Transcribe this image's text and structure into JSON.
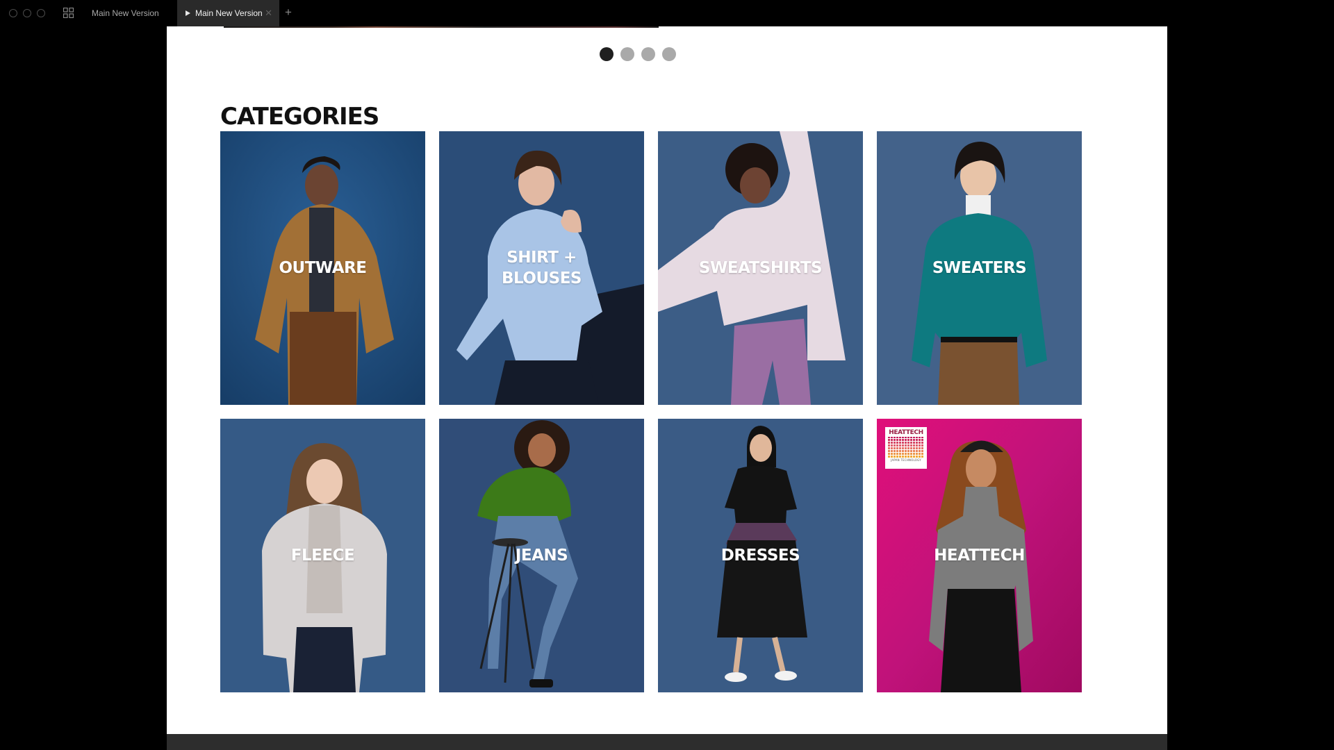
{
  "window": {
    "tabs": [
      {
        "label": "Main New Version",
        "active": false
      },
      {
        "label": "Main New Version",
        "active": true
      }
    ],
    "close_glyph": "✕",
    "new_tab_glyph": "+"
  },
  "carousel": {
    "total_slides": 4,
    "active_index": 0
  },
  "categories": {
    "title": "CATEGORIES",
    "items": [
      {
        "label": "OUTWARE",
        "bg_color": "#1f4a7a",
        "figure": "puffer-jacket"
      },
      {
        "label": "SHIRT +\nBLOUSES",
        "bg_color": "#2b4d78",
        "figure": "blue-shirt"
      },
      {
        "label": "SWEATSHIRTS",
        "bg_color": "#3c5d86",
        "figure": "lilac-sweatshirt"
      },
      {
        "label": "SWEATERS",
        "bg_color": "#43628a",
        "figure": "teal-cardigan"
      },
      {
        "label": "FLEECE",
        "bg_color": "#355a86",
        "figure": "fleece-jacket"
      },
      {
        "label": "JEANS",
        "bg_color": "#304d78",
        "figure": "green-sweater-jeans"
      },
      {
        "label": "DRESSES",
        "bg_color": "#3a5b85",
        "figure": "black-dress"
      },
      {
        "label": "HEATTECH",
        "bg_color": "#c4117a",
        "figure": "grey-turtleneck"
      }
    ],
    "heattech_logo": {
      "title": "HEATTECH",
      "subtitle": "JAPAN TECHNOLOGY"
    }
  }
}
